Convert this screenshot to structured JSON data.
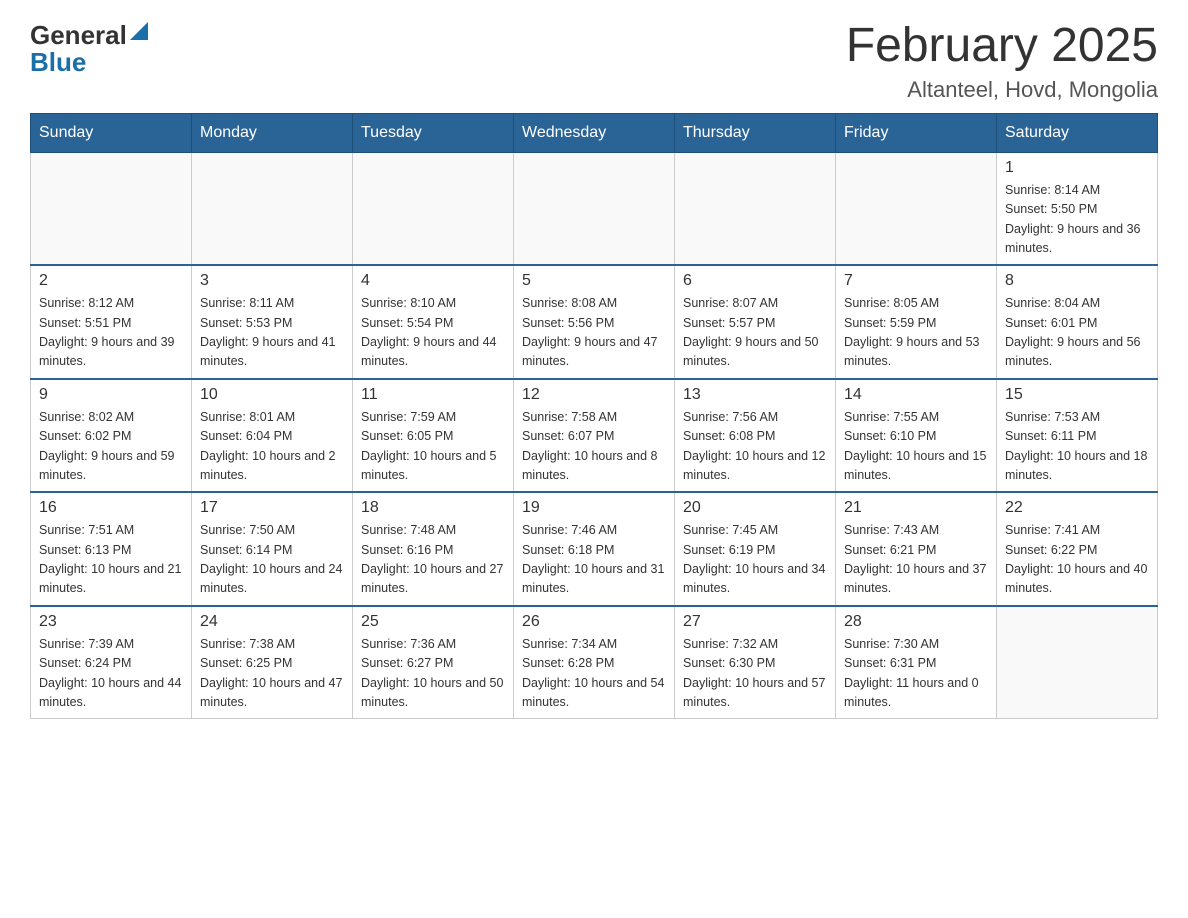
{
  "header": {
    "logo_general": "General",
    "logo_blue": "Blue",
    "month_year": "February 2025",
    "location": "Altanteel, Hovd, Mongolia"
  },
  "weekdays": [
    "Sunday",
    "Monday",
    "Tuesday",
    "Wednesday",
    "Thursday",
    "Friday",
    "Saturday"
  ],
  "weeks": [
    [
      {
        "day": "",
        "info": ""
      },
      {
        "day": "",
        "info": ""
      },
      {
        "day": "",
        "info": ""
      },
      {
        "day": "",
        "info": ""
      },
      {
        "day": "",
        "info": ""
      },
      {
        "day": "",
        "info": ""
      },
      {
        "day": "1",
        "info": "Sunrise: 8:14 AM\nSunset: 5:50 PM\nDaylight: 9 hours and 36 minutes."
      }
    ],
    [
      {
        "day": "2",
        "info": "Sunrise: 8:12 AM\nSunset: 5:51 PM\nDaylight: 9 hours and 39 minutes."
      },
      {
        "day": "3",
        "info": "Sunrise: 8:11 AM\nSunset: 5:53 PM\nDaylight: 9 hours and 41 minutes."
      },
      {
        "day": "4",
        "info": "Sunrise: 8:10 AM\nSunset: 5:54 PM\nDaylight: 9 hours and 44 minutes."
      },
      {
        "day": "5",
        "info": "Sunrise: 8:08 AM\nSunset: 5:56 PM\nDaylight: 9 hours and 47 minutes."
      },
      {
        "day": "6",
        "info": "Sunrise: 8:07 AM\nSunset: 5:57 PM\nDaylight: 9 hours and 50 minutes."
      },
      {
        "day": "7",
        "info": "Sunrise: 8:05 AM\nSunset: 5:59 PM\nDaylight: 9 hours and 53 minutes."
      },
      {
        "day": "8",
        "info": "Sunrise: 8:04 AM\nSunset: 6:01 PM\nDaylight: 9 hours and 56 minutes."
      }
    ],
    [
      {
        "day": "9",
        "info": "Sunrise: 8:02 AM\nSunset: 6:02 PM\nDaylight: 9 hours and 59 minutes."
      },
      {
        "day": "10",
        "info": "Sunrise: 8:01 AM\nSunset: 6:04 PM\nDaylight: 10 hours and 2 minutes."
      },
      {
        "day": "11",
        "info": "Sunrise: 7:59 AM\nSunset: 6:05 PM\nDaylight: 10 hours and 5 minutes."
      },
      {
        "day": "12",
        "info": "Sunrise: 7:58 AM\nSunset: 6:07 PM\nDaylight: 10 hours and 8 minutes."
      },
      {
        "day": "13",
        "info": "Sunrise: 7:56 AM\nSunset: 6:08 PM\nDaylight: 10 hours and 12 minutes."
      },
      {
        "day": "14",
        "info": "Sunrise: 7:55 AM\nSunset: 6:10 PM\nDaylight: 10 hours and 15 minutes."
      },
      {
        "day": "15",
        "info": "Sunrise: 7:53 AM\nSunset: 6:11 PM\nDaylight: 10 hours and 18 minutes."
      }
    ],
    [
      {
        "day": "16",
        "info": "Sunrise: 7:51 AM\nSunset: 6:13 PM\nDaylight: 10 hours and 21 minutes."
      },
      {
        "day": "17",
        "info": "Sunrise: 7:50 AM\nSunset: 6:14 PM\nDaylight: 10 hours and 24 minutes."
      },
      {
        "day": "18",
        "info": "Sunrise: 7:48 AM\nSunset: 6:16 PM\nDaylight: 10 hours and 27 minutes."
      },
      {
        "day": "19",
        "info": "Sunrise: 7:46 AM\nSunset: 6:18 PM\nDaylight: 10 hours and 31 minutes."
      },
      {
        "day": "20",
        "info": "Sunrise: 7:45 AM\nSunset: 6:19 PM\nDaylight: 10 hours and 34 minutes."
      },
      {
        "day": "21",
        "info": "Sunrise: 7:43 AM\nSunset: 6:21 PM\nDaylight: 10 hours and 37 minutes."
      },
      {
        "day": "22",
        "info": "Sunrise: 7:41 AM\nSunset: 6:22 PM\nDaylight: 10 hours and 40 minutes."
      }
    ],
    [
      {
        "day": "23",
        "info": "Sunrise: 7:39 AM\nSunset: 6:24 PM\nDaylight: 10 hours and 44 minutes."
      },
      {
        "day": "24",
        "info": "Sunrise: 7:38 AM\nSunset: 6:25 PM\nDaylight: 10 hours and 47 minutes."
      },
      {
        "day": "25",
        "info": "Sunrise: 7:36 AM\nSunset: 6:27 PM\nDaylight: 10 hours and 50 minutes."
      },
      {
        "day": "26",
        "info": "Sunrise: 7:34 AM\nSunset: 6:28 PM\nDaylight: 10 hours and 54 minutes."
      },
      {
        "day": "27",
        "info": "Sunrise: 7:32 AM\nSunset: 6:30 PM\nDaylight: 10 hours and 57 minutes."
      },
      {
        "day": "28",
        "info": "Sunrise: 7:30 AM\nSunset: 6:31 PM\nDaylight: 11 hours and 0 minutes."
      },
      {
        "day": "",
        "info": ""
      }
    ]
  ]
}
